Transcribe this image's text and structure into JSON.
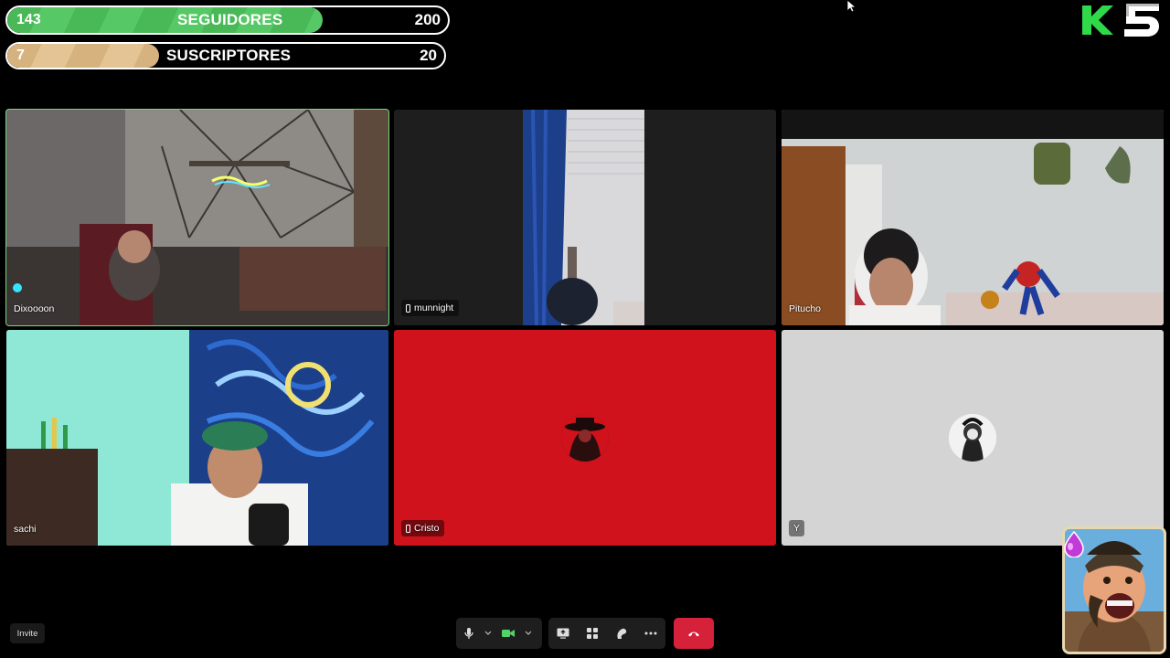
{
  "goals": [
    {
      "label": "SEGUIDORES",
      "current": "143",
      "target": "200",
      "progress": 0.715,
      "color": "#4fbe5c"
    },
    {
      "label": "SUSCRIPTORES",
      "current": "7",
      "target": "20",
      "progress": 0.35,
      "color": "#dcb985"
    }
  ],
  "participants": [
    {
      "name": "Dixoooon",
      "state": "camera",
      "speaking": true
    },
    {
      "name": "munnight",
      "state": "camera",
      "device": "phone-icon"
    },
    {
      "name": "Pitucho",
      "state": "camera"
    },
    {
      "name": "sachi",
      "state": "camera"
    },
    {
      "name": "Cristo",
      "state": "avatar",
      "device": "phone-icon",
      "bg": "#d0121c"
    },
    {
      "name": "Y",
      "state": "avatar",
      "bg": "#d4d4d4"
    }
  ],
  "toolbar": {
    "invite_label": "Invite",
    "mic": "mic-icon",
    "camera": "camera-icon",
    "screen_share": "screen-share-icon",
    "apps": "apps-icon",
    "soundboard": "soundboard-icon",
    "more": "more-icon",
    "leave": "hang-up-icon"
  },
  "colors": {
    "accent_green": "#6fdc7a",
    "leave_red": "#d6213a",
    "camera_on": "#4fd46a"
  }
}
